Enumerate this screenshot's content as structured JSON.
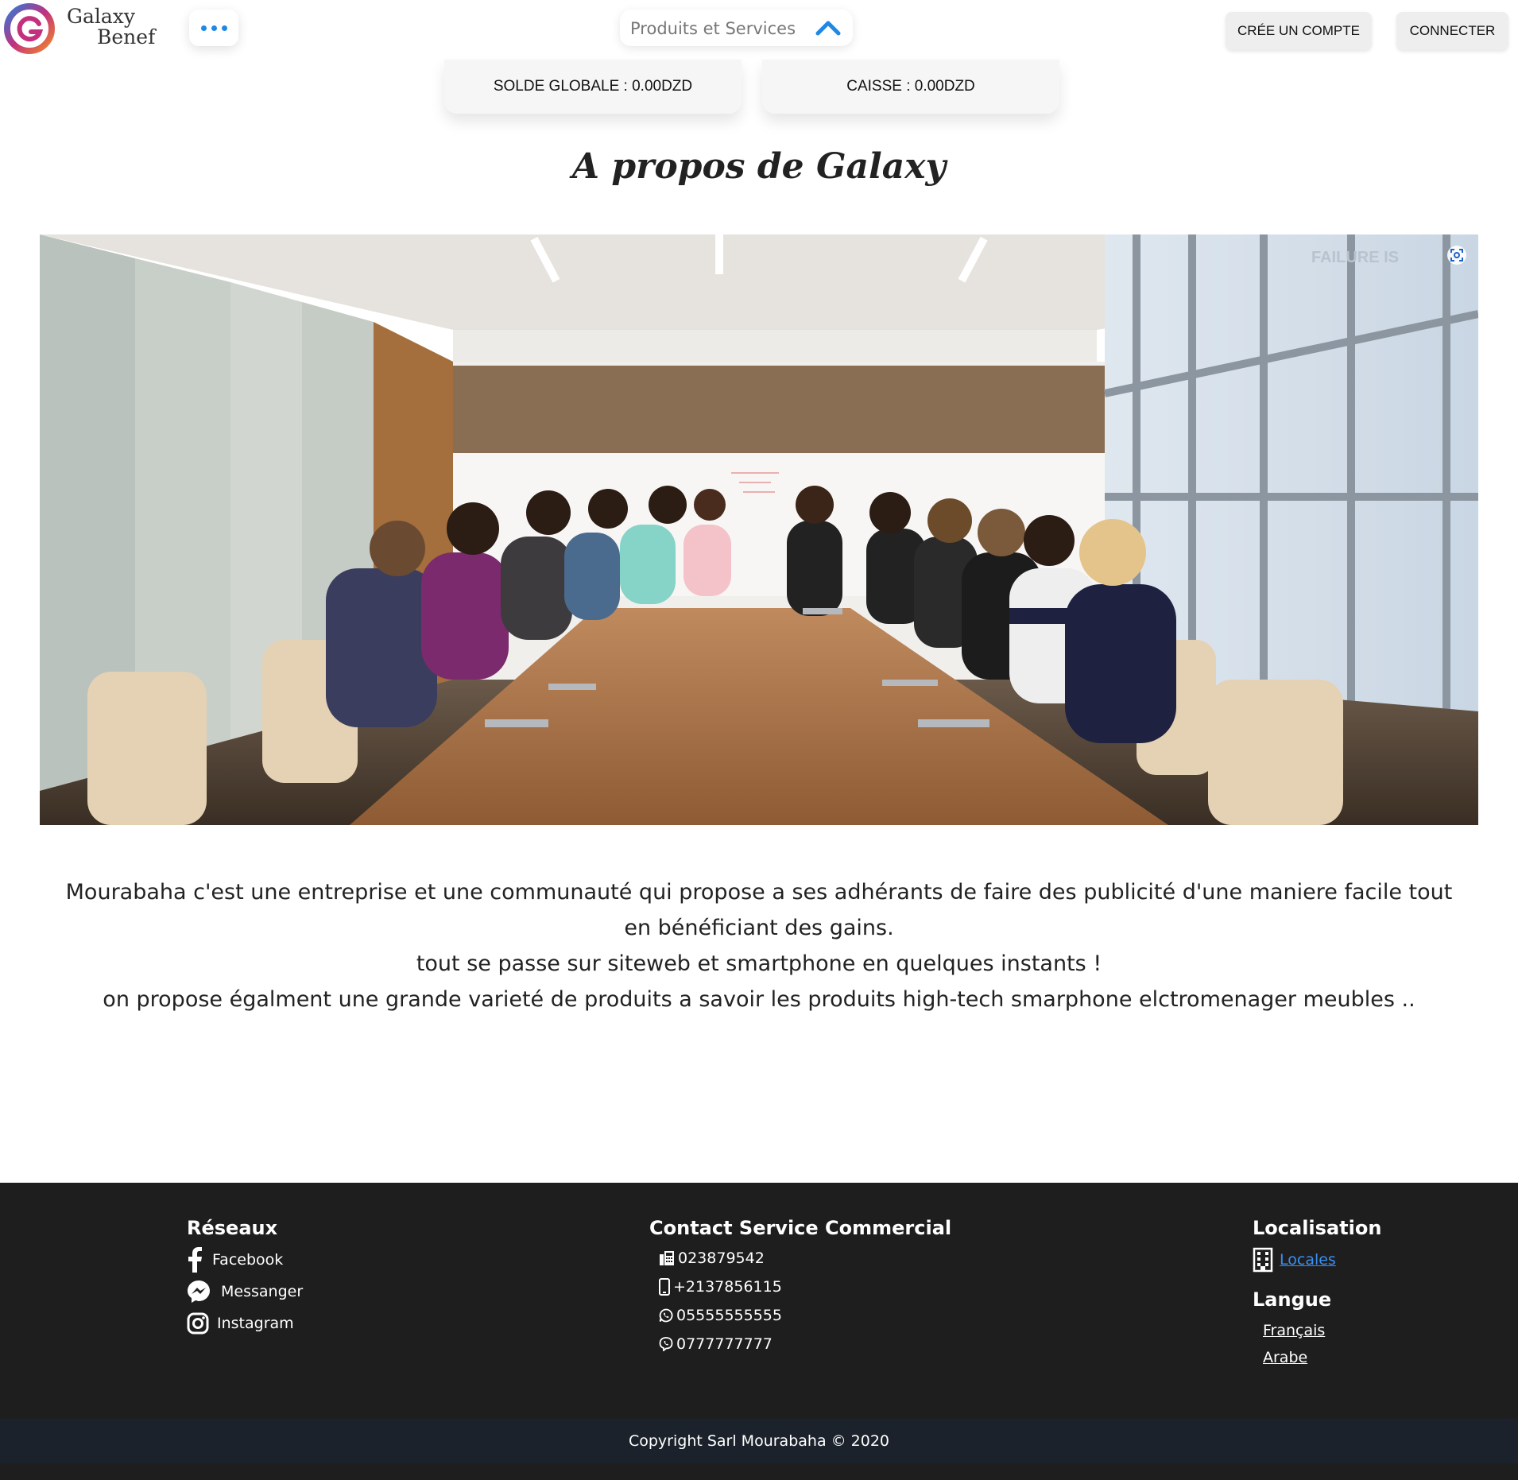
{
  "header": {
    "brand_line1": "Galaxy",
    "brand_line2": "Benef",
    "products_dropdown": "Produits et Services",
    "create_account": "CRÉE UN COMPTE",
    "connect": "CONNECTER"
  },
  "balances": {
    "solde": "SOLDE GLOBALE : 0.00DZD",
    "caisse": "CAISSE : 0.00DZD"
  },
  "about": {
    "title": "A propos de Galaxy",
    "paragraphs": [
      "Mourabaha c'est une entreprise et une communauté qui propose a ses adhérants de faire des publicité d'une maniere facile tout en bénéficiant des gains.",
      "tout se passe sur siteweb et smartphone en quelques instants !",
      "on propose égalment une grande varieté de produits a savoir les produits high-tech smarphone elctromenager meubles .."
    ],
    "photo_watermark": "FAILURE IS"
  },
  "footer": {
    "reseaux": {
      "title": "Réseaux",
      "items": [
        {
          "label": "Facebook",
          "icon": "facebook-icon"
        },
        {
          "label": "Messanger",
          "icon": "messenger-icon"
        },
        {
          "label": "Instagram",
          "icon": "instagram-icon"
        }
      ]
    },
    "contact": {
      "title": "Contact Service Commercial",
      "items": [
        {
          "label": "023879542",
          "icon": "fax-icon"
        },
        {
          "label": "+2137856115",
          "icon": "mobile-icon"
        },
        {
          "label": "05555555555",
          "icon": "whatsapp-icon"
        },
        {
          "label": "0777777777",
          "icon": "viber-icon"
        }
      ]
    },
    "localisation": {
      "title": "Localisation",
      "link": "Locales",
      "icon": "building-icon"
    },
    "langue": {
      "title": "Langue",
      "options": [
        "Français",
        "Arabe"
      ]
    },
    "copyright": "Copyright Sarl Mourabaha © 2020"
  },
  "colors": {
    "accent": "#1e88e5",
    "footer_bg": "#1e1e1e",
    "copyright_bg": "#1b222b"
  }
}
